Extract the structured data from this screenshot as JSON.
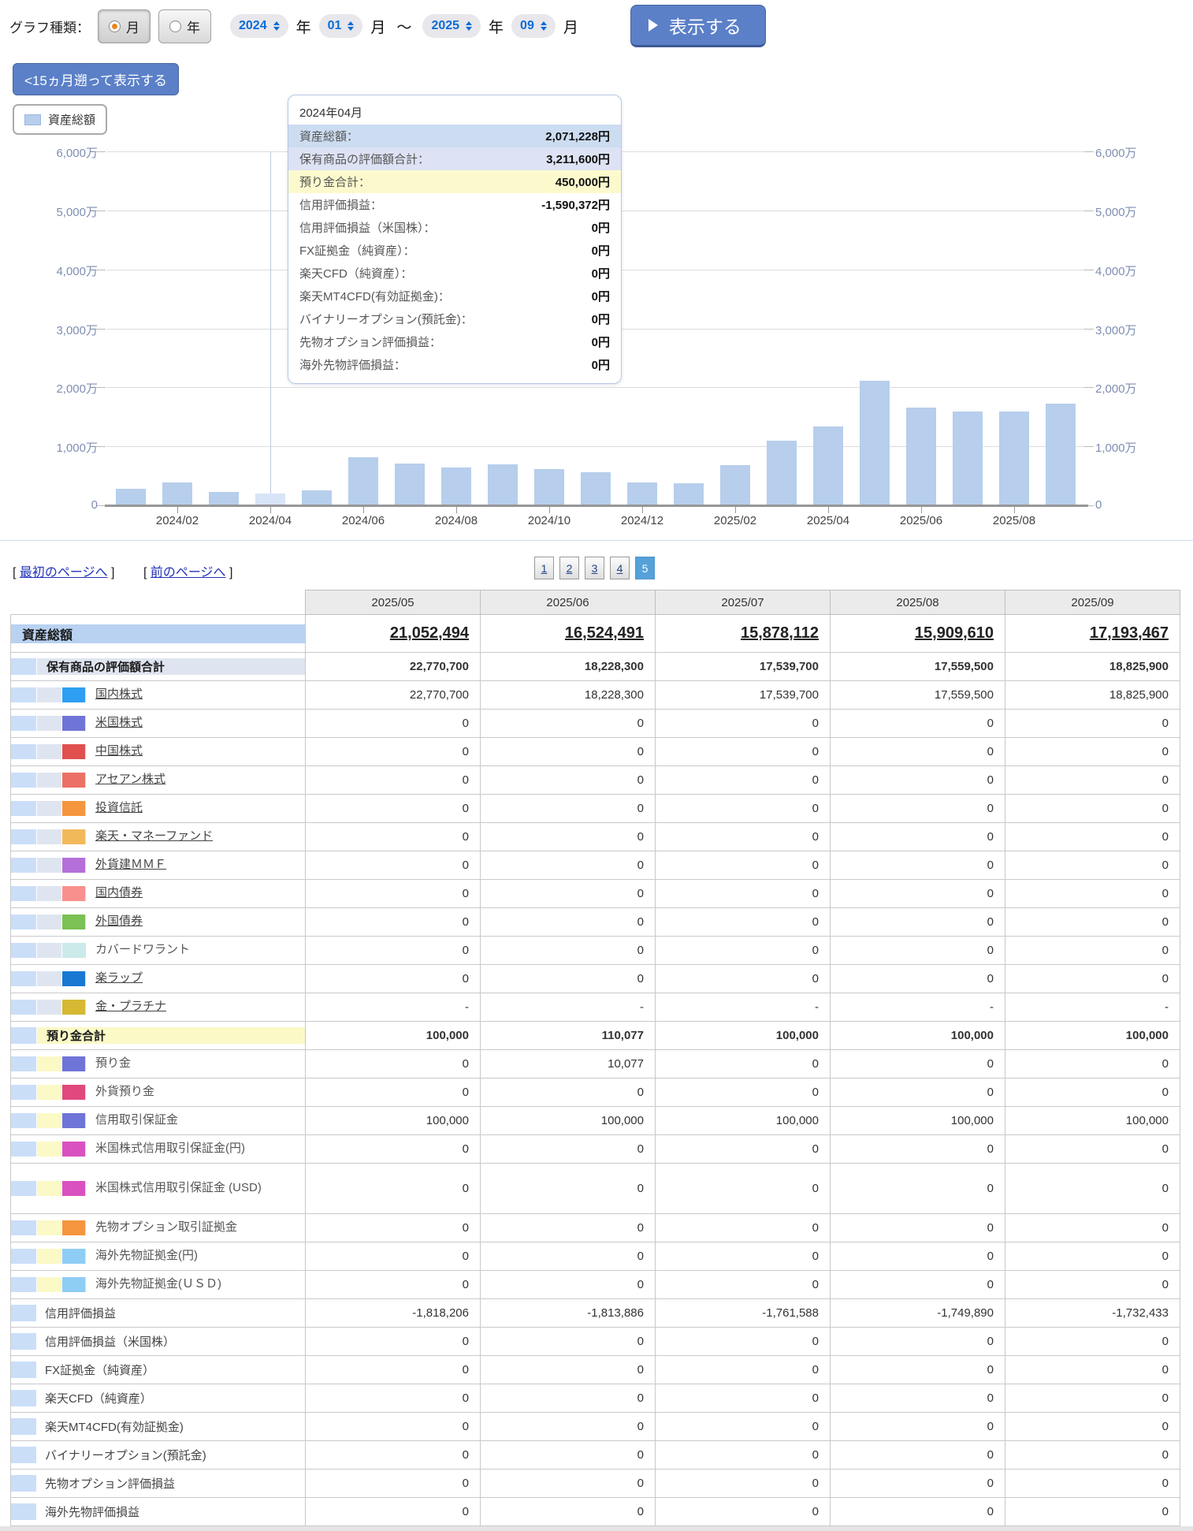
{
  "controls": {
    "graph_type_label": "グラフ種類：",
    "radio_month": "月",
    "radio_year": "年",
    "from_year": "2024",
    "from_month": "01",
    "to_year": "2025",
    "to_month": "09",
    "year_unit": "年",
    "month_unit": "月",
    "range_separator": "～",
    "show_button": "表示する",
    "back_button": "<15ヵ月遡って表示する"
  },
  "legend": {
    "label": "資産総額"
  },
  "tooltip": {
    "title": "2024年04月",
    "rows": [
      {
        "label": "資産総額：",
        "value": "2,071,228円",
        "band": "blue"
      },
      {
        "label": "保有商品の評価額合計：",
        "value": "3,211,600円",
        "band": "lavender"
      },
      {
        "label": "預り金合計：",
        "value": "450,000円",
        "band": "yellow"
      },
      {
        "label": "信用評価損益：",
        "value": "-1,590,372円",
        "band": ""
      },
      {
        "label": "信用評価損益（米国株）：",
        "value": "0円",
        "band": ""
      },
      {
        "label": "FX証拠金（純資産）：",
        "value": "0円",
        "band": ""
      },
      {
        "label": "楽天CFD（純資産）：",
        "value": "0円",
        "band": ""
      },
      {
        "label": "楽天MT4CFD(有効証拠金)：",
        "value": "0円",
        "band": ""
      },
      {
        "label": "バイナリーオプション(預託金)：",
        "value": "0円",
        "band": ""
      },
      {
        "label": "先物オプション評価損益：",
        "value": "0円",
        "band": ""
      },
      {
        "label": "海外先物評価損益：",
        "value": "0円",
        "band": ""
      }
    ]
  },
  "chart_data": {
    "type": "bar",
    "series_name": "資産総額",
    "x": [
      "2024/01",
      "2024/02",
      "2024/03",
      "2024/04",
      "2024/05",
      "2024/06",
      "2024/07",
      "2024/08",
      "2024/09",
      "2024/10",
      "2024/11",
      "2024/12",
      "2025/01",
      "2025/02",
      "2025/03",
      "2025/04",
      "2025/05",
      "2025/06",
      "2025/07",
      "2025/08",
      "2025/09"
    ],
    "values": [
      2800000,
      3900000,
      2300000,
      2071228,
      2500000,
      8200000,
      7100000,
      6400000,
      7000000,
      6200000,
      5600000,
      3900000,
      3800000,
      6800000,
      10900000,
      13400000,
      21052494,
      16524491,
      15878112,
      15909610,
      17193467
    ],
    "highlight_index": 3,
    "x_tick_labels": [
      "2024/02",
      "2024/04",
      "2024/06",
      "2024/08",
      "2024/10",
      "2024/12",
      "2025/02",
      "2025/04",
      "2025/06",
      "2025/08"
    ],
    "y_ticks": [
      "0",
      "1,000万",
      "2,000万",
      "3,000万",
      "4,000万",
      "5,000万",
      "6,000万"
    ],
    "ylim": [
      0,
      60000000
    ],
    "grid": true,
    "bar_color": "#b7ceec",
    "bar_highlight_color": "#d8e4f7",
    "legend_position": "top-left"
  },
  "pagination": {
    "first_link": "最初のページへ",
    "prev_link": "前のページへ",
    "bracket_open": "[",
    "bracket_close": "]",
    "pages": [
      "1",
      "2",
      "3",
      "4",
      "5"
    ],
    "active_page": "5"
  },
  "table": {
    "columns": [
      "2025/05",
      "2025/06",
      "2025/07",
      "2025/08",
      "2025/09"
    ],
    "rows": [
      {
        "label": "資産総額",
        "type": "l1",
        "link": true,
        "values": [
          "21,052,494",
          "16,524,491",
          "15,878,112",
          "15,909,610",
          "17,193,467"
        ]
      },
      {
        "label": "保有商品の評価額合計",
        "type": "l2",
        "section": "blue",
        "values": [
          "22,770,700",
          "18,228,300",
          "17,539,700",
          "17,559,500",
          "18,825,900"
        ]
      },
      {
        "label": "国内株式",
        "type": "item",
        "section": "blue",
        "swatch": "#2e9ff2",
        "link": true,
        "values": [
          "22,770,700",
          "18,228,300",
          "17,539,700",
          "17,559,500",
          "18,825,900"
        ]
      },
      {
        "label": "米国株式",
        "type": "item",
        "section": "blue",
        "swatch": "#6f74d8",
        "link": true,
        "values": [
          "0",
          "0",
          "0",
          "0",
          "0"
        ]
      },
      {
        "label": "中国株式",
        "type": "item",
        "section": "blue",
        "swatch": "#e0504f",
        "link": true,
        "values": [
          "0",
          "0",
          "0",
          "0",
          "0"
        ]
      },
      {
        "label": "アセアン株式",
        "type": "item",
        "section": "blue",
        "swatch": "#ec7065",
        "link": true,
        "values": [
          "0",
          "0",
          "0",
          "0",
          "0"
        ]
      },
      {
        "label": "投資信託",
        "type": "item",
        "section": "blue",
        "swatch": "#f5953d",
        "link": true,
        "values": [
          "0",
          "0",
          "0",
          "0",
          "0"
        ]
      },
      {
        "label": "楽天・マネーファンド",
        "type": "item",
        "section": "blue",
        "swatch": "#f2b95b",
        "link": true,
        "values": [
          "0",
          "0",
          "0",
          "0",
          "0"
        ]
      },
      {
        "label": "外貨建ＭＭＦ",
        "type": "item",
        "section": "blue",
        "swatch": "#b56fd8",
        "link": true,
        "values": [
          "0",
          "0",
          "0",
          "0",
          "0"
        ]
      },
      {
        "label": "国内債券",
        "type": "item",
        "section": "blue",
        "swatch": "#f8908e",
        "link": true,
        "values": [
          "0",
          "0",
          "0",
          "0",
          "0"
        ]
      },
      {
        "label": "外国債券",
        "type": "item",
        "section": "blue",
        "swatch": "#7bc153",
        "link": true,
        "values": [
          "0",
          "0",
          "0",
          "0",
          "0"
        ]
      },
      {
        "label": "カバードワラント",
        "type": "item",
        "section": "blue",
        "swatch": "#cdeaea",
        "link": false,
        "values": [
          "0",
          "0",
          "0",
          "0",
          "0"
        ]
      },
      {
        "label": "楽ラップ",
        "type": "item",
        "section": "blue",
        "swatch": "#1878d2",
        "link": true,
        "values": [
          "0",
          "0",
          "0",
          "0",
          "0"
        ]
      },
      {
        "label": "金・プラチナ",
        "type": "item",
        "section": "blue",
        "swatch": "#d6b832",
        "link": true,
        "values": [
          "-",
          "-",
          "-",
          "-",
          "-"
        ]
      },
      {
        "label": "預り金合計",
        "type": "l2",
        "section": "yellow",
        "values": [
          "100,000",
          "110,077",
          "100,000",
          "100,000",
          "100,000"
        ]
      },
      {
        "label": "預り金",
        "type": "item",
        "section": "yellow",
        "swatch": "#6f74d8",
        "link": false,
        "values": [
          "0",
          "10,077",
          "0",
          "0",
          "0"
        ]
      },
      {
        "label": "外貨預り金",
        "type": "item",
        "section": "yellow",
        "swatch": "#e0487e",
        "link": false,
        "values": [
          "0",
          "0",
          "0",
          "0",
          "0"
        ]
      },
      {
        "label": "信用取引保証金",
        "type": "item",
        "section": "yellow",
        "swatch": "#6f74d8",
        "link": false,
        "values": [
          "100,000",
          "100,000",
          "100,000",
          "100,000",
          "100,000"
        ]
      },
      {
        "label": "米国株式信用取引保証金(円)",
        "type": "item",
        "section": "yellow",
        "swatch": "#d951c0",
        "link": false,
        "values": [
          "0",
          "0",
          "0",
          "0",
          "0"
        ]
      },
      {
        "label": "米国株式信用取引保証金 (USD)",
        "type": "item",
        "section": "yellow",
        "swatch": "#d951c0",
        "link": false,
        "tall": true,
        "values": [
          "0",
          "0",
          "0",
          "0",
          "0"
        ]
      },
      {
        "label": "先物オプション取引証拠金",
        "type": "item",
        "section": "yellow",
        "swatch": "#f5953d",
        "link": false,
        "values": [
          "0",
          "0",
          "0",
          "0",
          "0"
        ]
      },
      {
        "label": "海外先物証拠金(円)",
        "type": "item",
        "section": "yellow",
        "swatch": "#8ecdf5",
        "link": false,
        "values": [
          "0",
          "0",
          "0",
          "0",
          "0"
        ]
      },
      {
        "label": "海外先物証拠金(ＵＳＤ)",
        "type": "item",
        "section": "yellow",
        "swatch": "#8ecdf5",
        "link": false,
        "values": [
          "0",
          "0",
          "0",
          "0",
          "0"
        ]
      },
      {
        "label": "信用評価損益",
        "type": "plain",
        "values": [
          "-1,818,206",
          "-1,813,886",
          "-1,761,588",
          "-1,749,890",
          "-1,732,433"
        ]
      },
      {
        "label": "信用評価損益（米国株）",
        "type": "plain",
        "values": [
          "0",
          "0",
          "0",
          "0",
          "0"
        ]
      },
      {
        "label": "FX証拠金（純資産）",
        "type": "plain",
        "values": [
          "0",
          "0",
          "0",
          "0",
          "0"
        ]
      },
      {
        "label": "楽天CFD（純資産）",
        "type": "plain",
        "values": [
          "0",
          "0",
          "0",
          "0",
          "0"
        ]
      },
      {
        "label": "楽天MT4CFD(有効証拠金)",
        "type": "plain",
        "values": [
          "0",
          "0",
          "0",
          "0",
          "0"
        ]
      },
      {
        "label": "バイナリーオプション(預託金)",
        "type": "plain",
        "values": [
          "0",
          "0",
          "0",
          "0",
          "0"
        ]
      },
      {
        "label": "先物オプション評価損益",
        "type": "plain",
        "values": [
          "0",
          "0",
          "0",
          "0",
          "0"
        ]
      },
      {
        "label": "海外先物評価損益",
        "type": "plain",
        "values": [
          "0",
          "0",
          "0",
          "0",
          "0"
        ]
      }
    ]
  }
}
